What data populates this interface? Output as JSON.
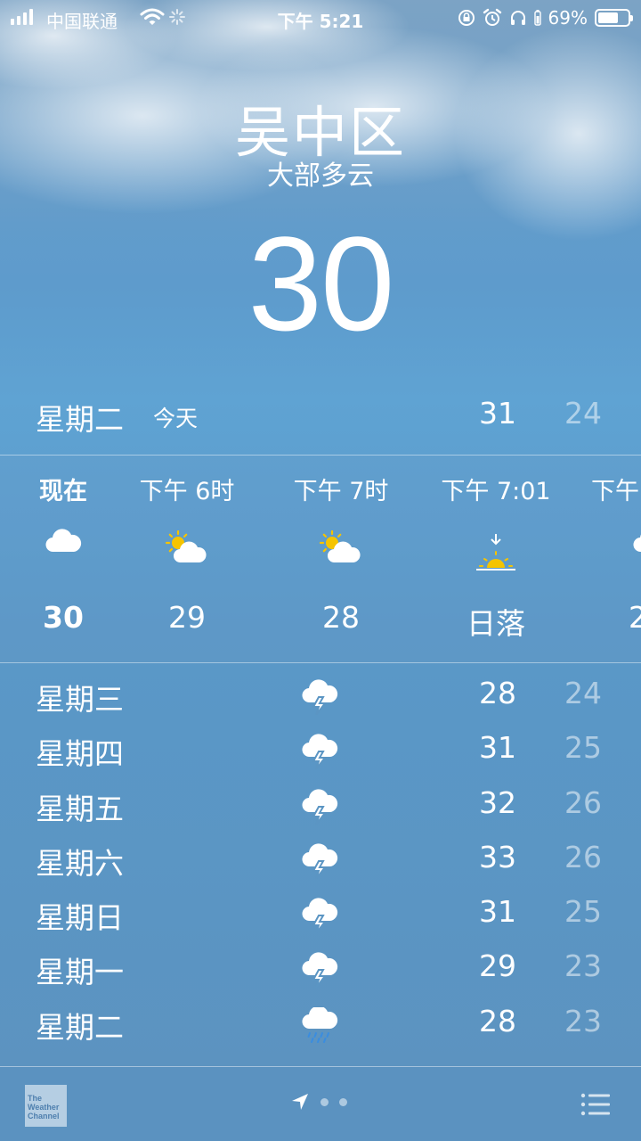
{
  "status_bar": {
    "carrier": "中国联通",
    "time": "下午 5:21",
    "battery_percent": "69%",
    "battery_level": 0.69
  },
  "location": "吴中区",
  "condition": "大部多云",
  "current_temp": "30",
  "today": {
    "day": "星期二",
    "tag": "今天",
    "high": "31",
    "low": "24"
  },
  "hourly": [
    {
      "time": "现在",
      "icon": "cloud-icon",
      "temp": "30"
    },
    {
      "time": "下午 6时",
      "icon": "partly-cloudy-icon",
      "temp": "29"
    },
    {
      "time": "下午 7时",
      "icon": "partly-cloudy-icon",
      "temp": "28"
    },
    {
      "time": "下午 7:01",
      "icon": "sunset-icon",
      "temp": "日落"
    },
    {
      "time": "下午",
      "icon": "cloud-icon",
      "temp": "2"
    }
  ],
  "daily": [
    {
      "day": "星期三",
      "icon": "thunderstorm-icon",
      "high": "28",
      "low": "24"
    },
    {
      "day": "星期四",
      "icon": "thunderstorm-icon",
      "high": "31",
      "low": "25"
    },
    {
      "day": "星期五",
      "icon": "thunderstorm-icon",
      "high": "32",
      "low": "26"
    },
    {
      "day": "星期六",
      "icon": "thunderstorm-icon",
      "high": "33",
      "low": "26"
    },
    {
      "day": "星期日",
      "icon": "thunderstorm-icon",
      "high": "31",
      "low": "25"
    },
    {
      "day": "星期一",
      "icon": "thunderstorm-icon",
      "high": "29",
      "low": "23"
    },
    {
      "day": "星期二",
      "icon": "rain-icon",
      "high": "28",
      "low": "23"
    }
  ],
  "footer": {
    "logo_text": "The Weather Channel"
  },
  "colors": {
    "sky": "#5e9bcc",
    "sun": "#f5c400",
    "low_temp": "rgba(255,255,255,0.5)"
  }
}
